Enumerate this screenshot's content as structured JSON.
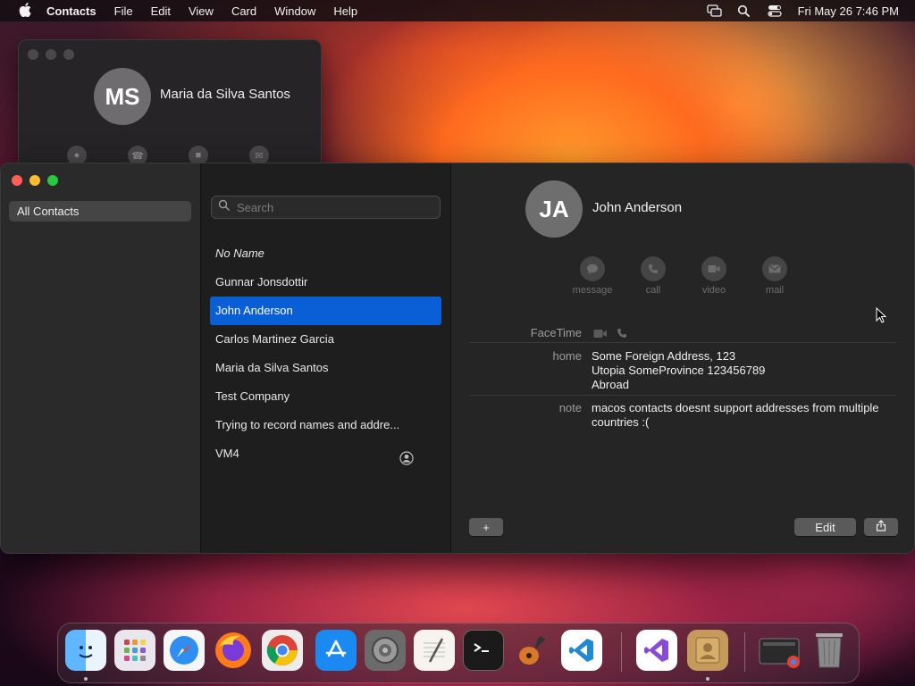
{
  "menubar": {
    "app_name": "Contacts",
    "menus": [
      "File",
      "Edit",
      "View",
      "Card",
      "Window",
      "Help"
    ],
    "clock": "Fri May 26  7:46 PM"
  },
  "back_window": {
    "initials": "MS",
    "name": "Maria da Silva Santos"
  },
  "sidebar": {
    "group": "All Contacts"
  },
  "search": {
    "placeholder": "Search"
  },
  "contacts": [
    "No Name",
    "Gunnar Jonsdottir",
    "John Anderson",
    "Carlos Martinez Garcia",
    "Maria da Silva Santos",
    "Test Company",
    "Trying to record names and addre...",
    "VM4"
  ],
  "selected_contact": "John Anderson",
  "card": {
    "initials": "JA",
    "name": "John Anderson",
    "actions": {
      "message": "message",
      "call": "call",
      "video": "video",
      "mail": "mail"
    },
    "facetime_label": "FaceTime",
    "home_label": "home",
    "address_line1": "Some Foreign Address, 123",
    "address_line2": "Utopia SomeProvince 123456789",
    "address_line3": "Abroad",
    "note_label": "note",
    "note_line1": "macos contacts doesnt support addresses from multiple",
    "note_line2": "countries :("
  },
  "buttons": {
    "add": "+",
    "edit": "Edit"
  },
  "dock_apps": [
    "finder-icon",
    "launchpad-icon",
    "safari-icon",
    "firefox-icon",
    "chrome-icon",
    "app-store-icon",
    "system-settings-icon",
    "textedit-icon",
    "terminal-icon",
    "garageband-icon",
    "vscode-icon",
    "visual-studio-icon",
    "contacts-icon",
    "chrome-app-icon",
    "trash-icon"
  ]
}
